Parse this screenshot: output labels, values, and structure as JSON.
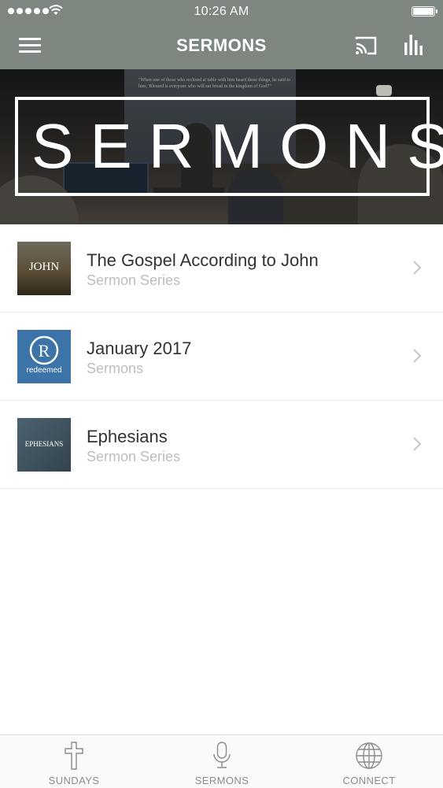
{
  "status_bar": {
    "time": "10:26 AM"
  },
  "nav": {
    "title": "SERMONS"
  },
  "hero": {
    "word": "SERMONS",
    "screen_text": "\"When one of those who reclined at table with him heard these things, he said to him, 'Blessed is everyone who will eat bread in the kingdom of God!'\"",
    "brand": "redeemed"
  },
  "list": [
    {
      "title": "The Gospel According to John",
      "subtitle": "Sermon Series",
      "thumb_text": "JOHN",
      "thumb_color": "#5b4f3a"
    },
    {
      "title": "January 2017",
      "subtitle": "Sermons",
      "thumb_text": "redeemed",
      "thumb_color": "#3c73a8"
    },
    {
      "title": "Ephesians",
      "subtitle": "Sermon Series",
      "thumb_text": "EPHESIANS",
      "thumb_color": "#3f5361"
    }
  ],
  "tabs": [
    {
      "label": "SUNDAYS",
      "icon": "cross-icon"
    },
    {
      "label": "SERMONS",
      "icon": "microphone-icon"
    },
    {
      "label": "CONNECT",
      "icon": "globe-icon"
    }
  ],
  "colors": {
    "header": "#7d8780",
    "text": "#333333",
    "muted": "#bdbdbd",
    "tab_label": "#8c8c8c"
  }
}
